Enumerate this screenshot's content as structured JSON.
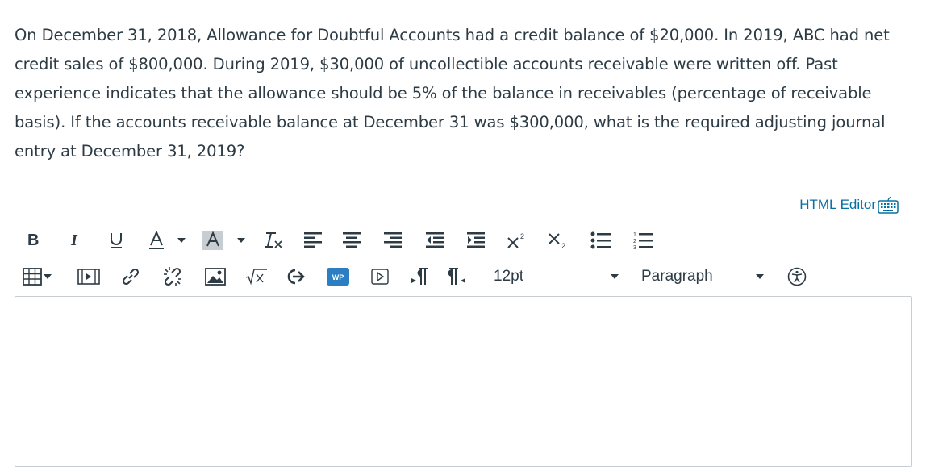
{
  "question": {
    "text": "On December 31, 2018, Allowance for Doubtful Accounts had a credit balance of $20,000. In 2019, ABC had net credit sales of $800,000.  During 2019, $30,000 of uncollectible accounts receivable were written off. Past experience indicates that the allowance should be 5% of the balance in receivables (percentage of receivable basis). If the accounts receivable balance at December 31 was $300,000, what is the required adjusting journal entry at December 31, 2019?"
  },
  "editor": {
    "html_editor_label": "HTML Editor",
    "font_size": "12pt",
    "block_format": "Paragraph",
    "wp_label": "WP",
    "content": ""
  },
  "icons": [
    "bold-icon",
    "italic-icon",
    "underline-icon",
    "text-color-icon",
    "background-color-icon",
    "clear-formatting-icon",
    "align-left-icon",
    "align-center-icon",
    "align-right-icon",
    "outdent-icon",
    "indent-icon",
    "superscript-icon",
    "subscript-icon",
    "bullet-list-icon",
    "numbered-list-icon",
    "table-icon",
    "media-icon",
    "link-icon",
    "unlink-icon",
    "image-icon",
    "math-icon",
    "embed-icon",
    "wordpress-icon",
    "video-icon",
    "ltr-icon",
    "rtl-icon",
    "accessibility-icon",
    "keyboard-icon"
  ],
  "colors": {
    "text": "#2d3b45",
    "link": "#0770a3",
    "border": "#c7cdd1"
  }
}
